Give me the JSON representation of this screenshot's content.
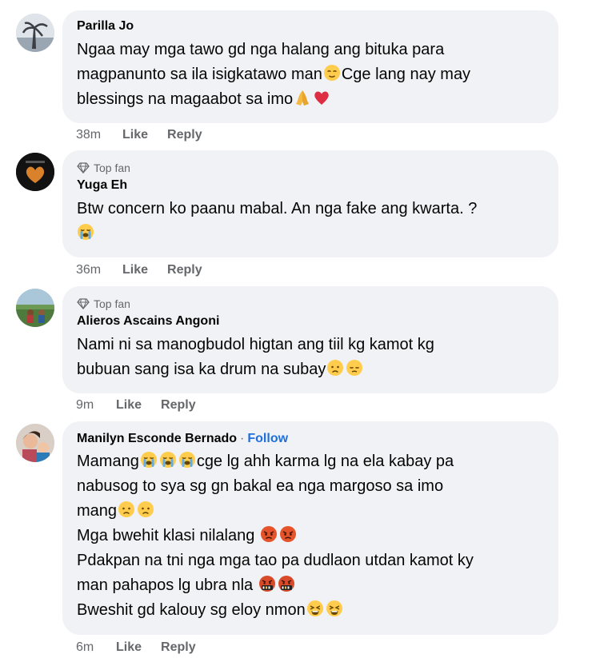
{
  "comments": [
    {
      "name": "Parilla Jo",
      "lines": [
        "Ngaa may mga tawo gd nga halang ang bituka para",
        "magpanunto sa ila isigkatawo man",
        "blessings na magaabot sa imo"
      ],
      "line2_suffix": "Cge lang nay may",
      "time": "38m",
      "like": "Like",
      "reply": "Reply"
    },
    {
      "badge": "Top fan",
      "name": "Yuga Eh",
      "lines": [
        "Btw concern ko paanu mabal. An nga fake ang kwarta. ?"
      ],
      "time": "36m",
      "like": "Like",
      "reply": "Reply"
    },
    {
      "badge": "Top fan",
      "name": "Alieros Ascains Angoni",
      "lines": [
        "Nami ni sa manogbudol higtan ang tiil kg kamot kg",
        "bubuan sang isa ka drum na subay"
      ],
      "time": "9m",
      "like": "Like",
      "reply": "Reply"
    },
    {
      "name": "Manilyn Esconde Bernado",
      "separator": "·",
      "follow": "Follow",
      "lines": [
        "Mamang",
        "cge lg ahh karma lg na ela kabay pa",
        "nabusog to sya sg gn bakal ea nga margoso sa imo",
        "mang",
        "Mga bwehit klasi nilalang",
        "Pdakpan na tni nga mga tao pa dudlaon utdan kamot ky",
        "man pahapos lg ubra nla",
        "Bweshit gd kalouy sg eloy nmon"
      ],
      "time": "6m",
      "like": "Like",
      "reply": "Reply"
    }
  ],
  "colors": {
    "bubble": "#f0f2f5",
    "meta": "#65676b",
    "follow": "#216fdb"
  }
}
